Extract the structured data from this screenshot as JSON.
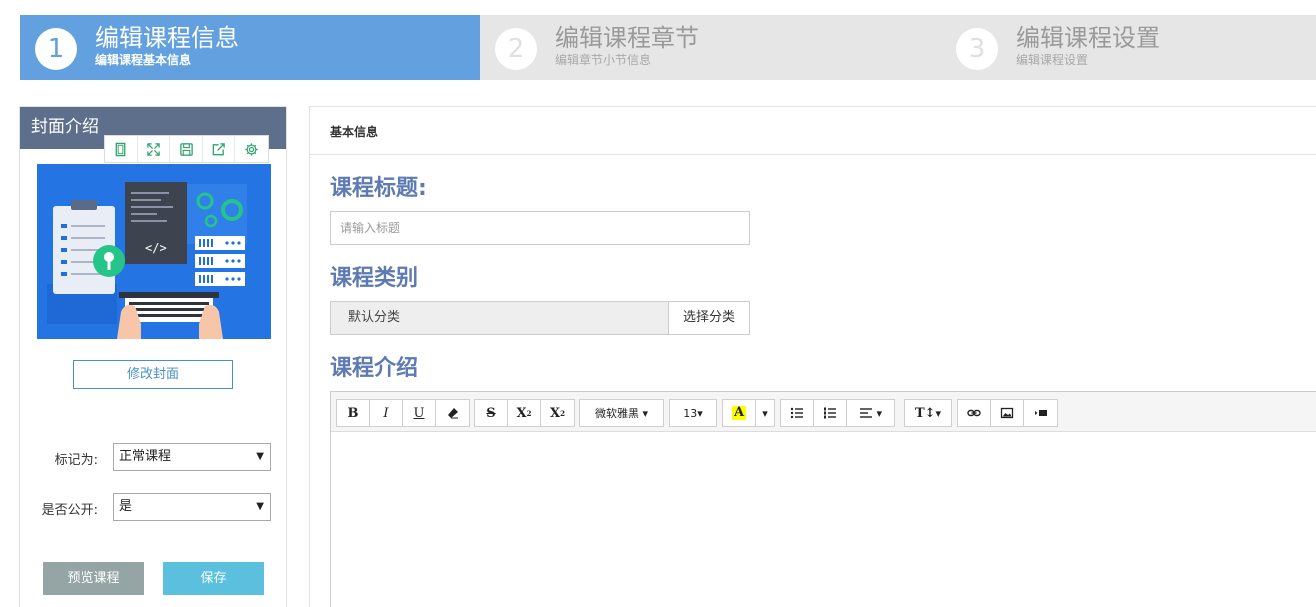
{
  "steps": [
    {
      "num": "1",
      "title": "编辑课程信息",
      "subtitle": "编辑课程基本信息"
    },
    {
      "num": "2",
      "title": "编辑课程章节",
      "subtitle": "编辑章节小节信息"
    },
    {
      "num": "3",
      "title": "编辑课程设置",
      "subtitle": "编辑课程设置"
    }
  ],
  "left": {
    "title": "封面介绍",
    "toolbar_icons": [
      "fit-screen-icon",
      "expand-icon",
      "save-icon",
      "share-icon",
      "settings-icon"
    ],
    "change_cover_label": "修改封面",
    "mark_label": "标记为:",
    "mark_value": "正常课程",
    "public_label": "是否公开:",
    "public_value": "是",
    "preview_label": "预览课程",
    "save_label": "保存"
  },
  "right": {
    "header_title": "基本信息",
    "course_title_label": "课程标题:",
    "title_placeholder": "请输入标题",
    "title_value": "",
    "category_label": "课程类别",
    "category_value": "默认分类",
    "category_button": "选择分类",
    "intro_label": "课程介绍"
  },
  "editor": {
    "font_family": "微软雅黑",
    "font_size": "13",
    "caret": "▾",
    "bold": "B",
    "italic": "I",
    "underline": "U",
    "strike": "S",
    "superscript": "X",
    "subscript": "X",
    "textcolor": "A",
    "heading": "T↕"
  },
  "colors": {
    "step_active": "#62a0df",
    "step_inactive": "#e6e6e6",
    "left_header": "#5d6f8b",
    "section_title": "#5e7ab3",
    "preview_btn": "#95a5a6",
    "save_btn": "#5bc0de"
  }
}
